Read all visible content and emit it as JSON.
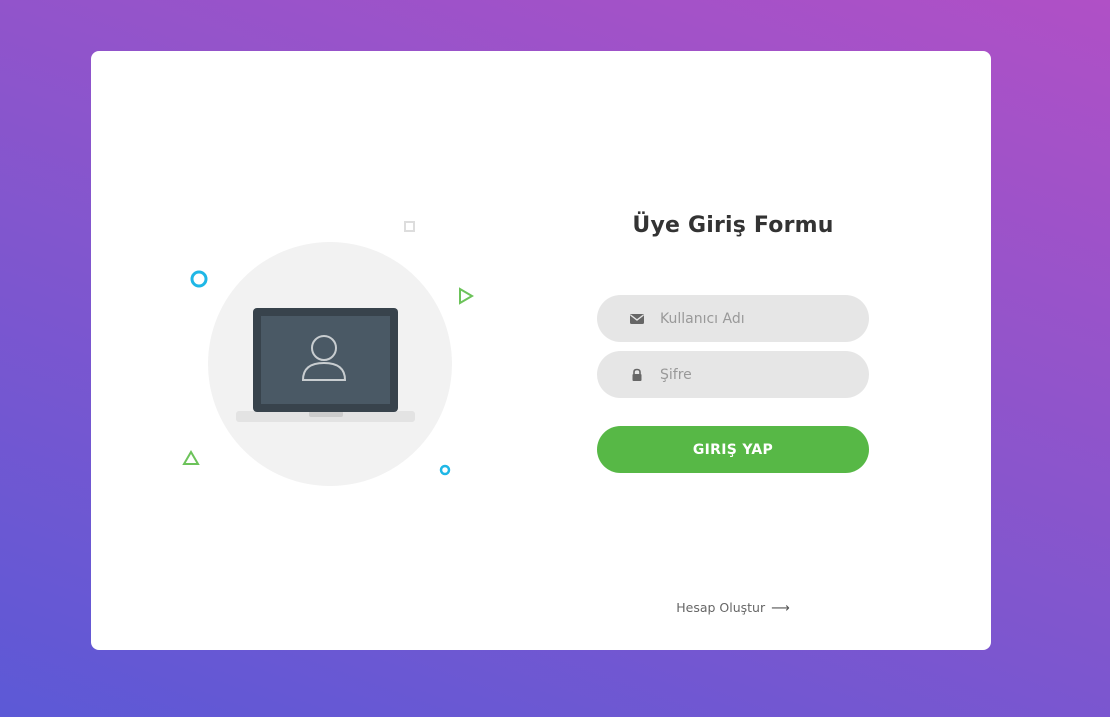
{
  "form": {
    "title": "Üye Giriş Formu",
    "username_placeholder": "Kullanıcı Adı",
    "password_placeholder": "Şifre",
    "login_label": "GIRIŞ YAP",
    "create_account_label": "Hesap Oluştur",
    "create_account_arrow": "⟶"
  },
  "icons": {
    "username": "envelope-icon",
    "password": "lock-icon",
    "illustration": "laptop-user-icon"
  },
  "colors": {
    "accent": "#57b846",
    "field_bg": "#e6e6e6",
    "title": "#333333",
    "bg_start": "#5c59d6",
    "bg_end": "#b050c6"
  }
}
